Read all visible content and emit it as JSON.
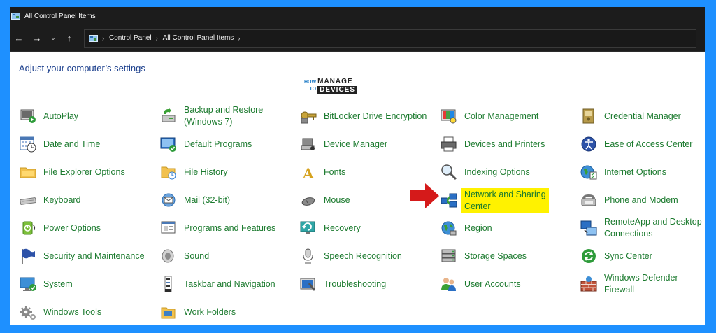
{
  "window": {
    "title": "All Control Panel Items"
  },
  "navbar": {
    "back_icon": "←",
    "forward_icon": "→",
    "recent_icon": "⌄",
    "up_icon": "↑",
    "breadcrumb": [
      "Control Panel",
      "All Control Panel Items"
    ],
    "crumb_separator": "›"
  },
  "content": {
    "heading": "Adjust your computer’s settings",
    "watermark": {
      "how": "HOW",
      "to": "TO",
      "manage": "MANAGE",
      "devices": "DEVICES"
    },
    "highlight_color": "#fff200",
    "arrow_color": "#d51a1a",
    "columns": [
      [
        {
          "label": "AutoPlay",
          "icon": "autoplay-icon"
        },
        {
          "label": "Date and Time",
          "icon": "calendar-clock-icon"
        },
        {
          "label": "File Explorer Options",
          "icon": "folder-options-icon"
        },
        {
          "label": "Keyboard",
          "icon": "keyboard-icon"
        },
        {
          "label": "Power Options",
          "icon": "power-icon"
        },
        {
          "label": "Security and Maintenance",
          "icon": "flag-icon"
        },
        {
          "label": "System",
          "icon": "monitor-check-icon"
        },
        {
          "label": "Windows Tools",
          "icon": "gears-icon"
        }
      ],
      [
        {
          "label": "Backup and Restore\n(Windows 7)",
          "icon": "backup-icon"
        },
        {
          "label": "Default Programs",
          "icon": "default-programs-icon"
        },
        {
          "label": "File History",
          "icon": "file-history-icon"
        },
        {
          "label": "Mail (32-bit)",
          "icon": "mail-icon"
        },
        {
          "label": "Programs and Features",
          "icon": "programs-icon"
        },
        {
          "label": "Sound",
          "icon": "speaker-icon"
        },
        {
          "label": "Taskbar and Navigation",
          "icon": "taskbar-icon"
        },
        {
          "label": "Work Folders",
          "icon": "work-folders-icon"
        }
      ],
      [
        {
          "label": "BitLocker Drive Encryption",
          "icon": "bitlocker-key-icon"
        },
        {
          "label": "Device Manager",
          "icon": "device-manager-icon"
        },
        {
          "label": "Fonts",
          "icon": "font-icon"
        },
        {
          "label": "Mouse",
          "icon": "mouse-icon"
        },
        {
          "label": "Recovery",
          "icon": "recovery-icon"
        },
        {
          "label": "Speech Recognition",
          "icon": "microphone-icon"
        },
        {
          "label": "Troubleshooting",
          "icon": "troubleshoot-icon"
        }
      ],
      [
        {
          "label": "Color Management",
          "icon": "color-icon"
        },
        {
          "label": "Devices and Printers",
          "icon": "printer-icon"
        },
        {
          "label": "Indexing Options",
          "icon": "indexing-icon"
        },
        {
          "label": "Network and Sharing\nCenter",
          "icon": "network-icon",
          "highlighted": true
        },
        {
          "label": "Region",
          "icon": "globe-icon"
        },
        {
          "label": "Storage Spaces",
          "icon": "storage-icon"
        },
        {
          "label": "User Accounts",
          "icon": "users-icon"
        }
      ],
      [
        {
          "label": "Credential Manager",
          "icon": "credential-icon"
        },
        {
          "label": "Ease of Access Center",
          "icon": "ease-access-icon"
        },
        {
          "label": "Internet Options",
          "icon": "internet-icon"
        },
        {
          "label": "Phone and Modem",
          "icon": "phone-icon"
        },
        {
          "label": "RemoteApp and Desktop\nConnections",
          "icon": "remote-desktop-icon"
        },
        {
          "label": "Sync Center",
          "icon": "sync-icon"
        },
        {
          "label": "Windows Defender\nFirewall",
          "icon": "firewall-icon"
        }
      ]
    ]
  }
}
